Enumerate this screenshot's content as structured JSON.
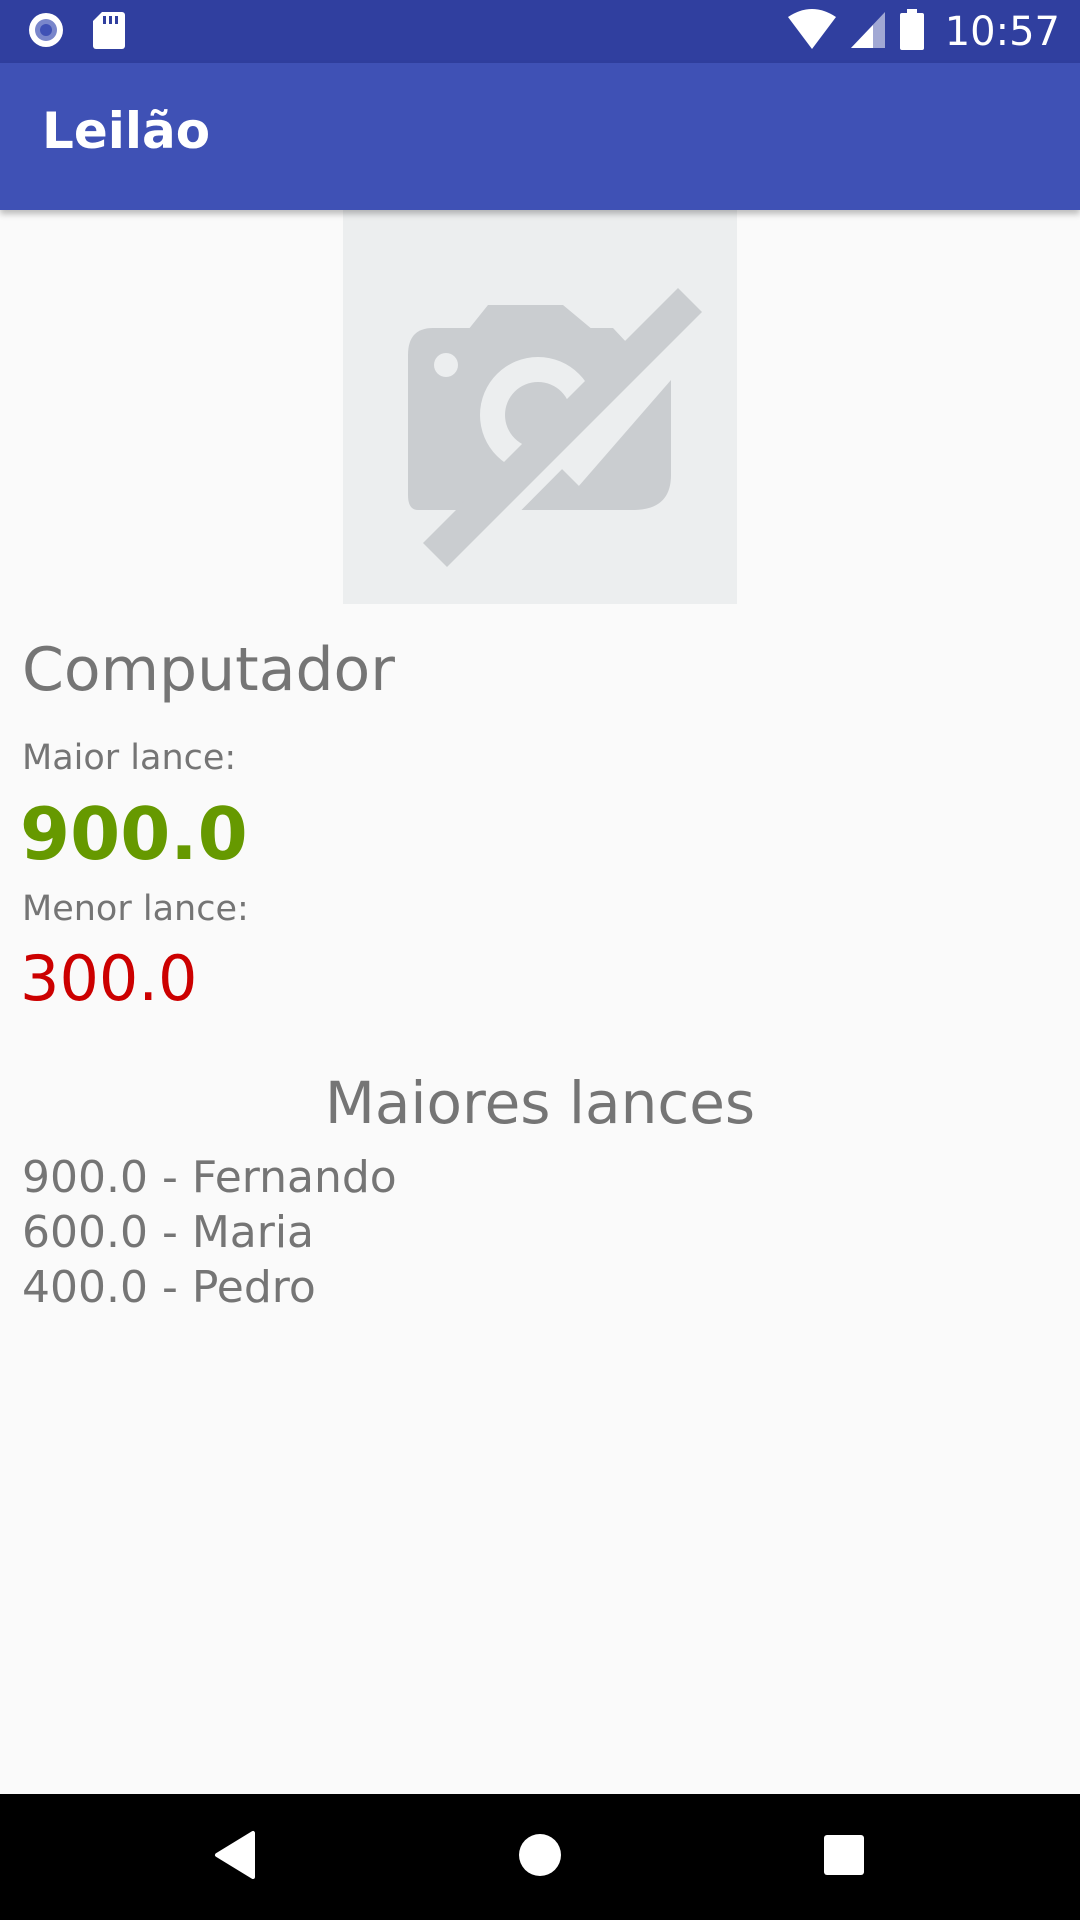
{
  "status_bar": {
    "time": "10:57",
    "icons": [
      "app-notification-icon",
      "sd-card-icon",
      "wifi-icon",
      "signal-icon",
      "battery-icon"
    ]
  },
  "app_bar": {
    "title": "Leilão"
  },
  "product": {
    "image_icon": "no-photo-icon",
    "name": "Computador"
  },
  "bids": {
    "max_label": "Maior lance:",
    "max_value": "900.0",
    "min_label": "Menor lance:",
    "min_value": "300.0"
  },
  "top_bids": {
    "title": "Maiores lances",
    "items": [
      "900.0 - Fernando",
      "600.0 - Maria",
      "400.0 - Pedro"
    ]
  },
  "colors": {
    "status_bar": "#303f9f",
    "app_bar": "#3f51b5",
    "max_value": "#669900",
    "min_value": "#cc0000",
    "text_secondary": "#757575"
  },
  "nav_bar": {
    "icons": [
      "back-icon",
      "home-icon",
      "recents-icon"
    ]
  }
}
